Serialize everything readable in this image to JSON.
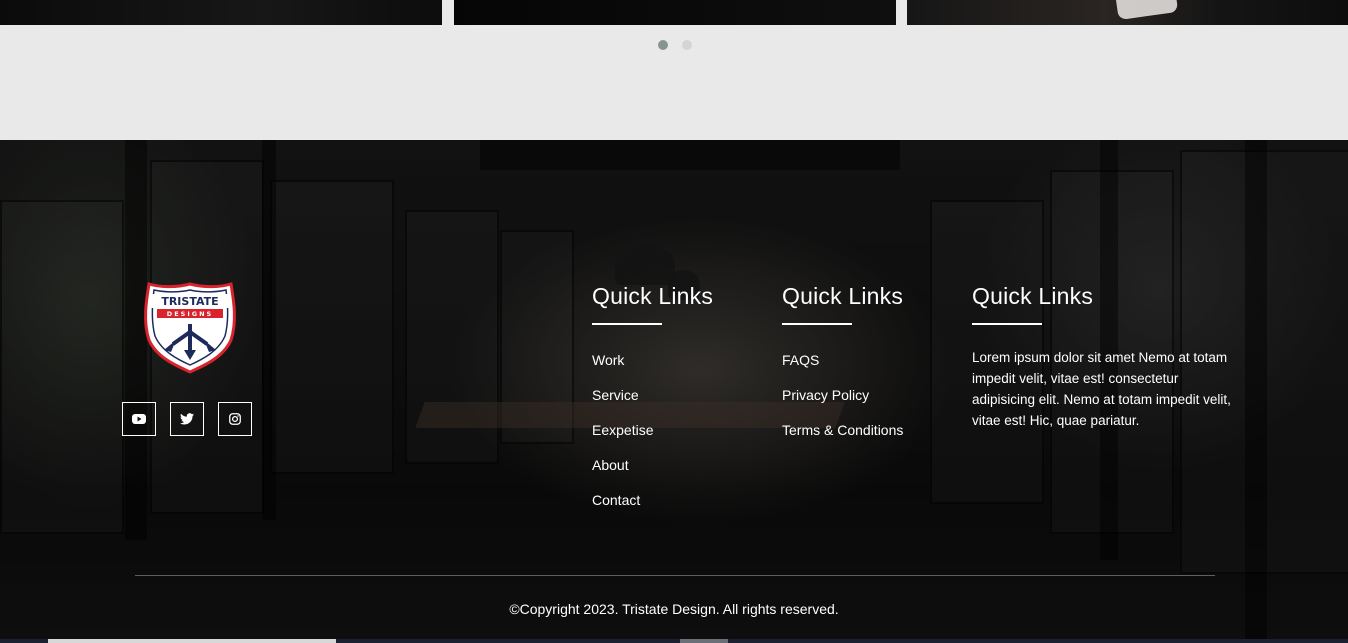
{
  "carousel": {
    "dots": [
      {
        "label": "slide-1",
        "active": true
      },
      {
        "label": "slide-2",
        "active": false
      }
    ]
  },
  "footer": {
    "logo": {
      "top_text": "TRISTATE",
      "sub_text": "DESIGNS",
      "colors": {
        "red": "#d9232d",
        "navy": "#1d2a5c",
        "white": "#ffffff"
      }
    },
    "socials": [
      {
        "name": "youtube-icon"
      },
      {
        "name": "twitter-icon"
      },
      {
        "name": "instagram-icon"
      }
    ],
    "columns": [
      {
        "heading": "Quick Links",
        "links": [
          "Work",
          "Service",
          "Eexpetise",
          "About",
          "Contact"
        ]
      },
      {
        "heading": "Quick Links",
        "links": [
          "FAQS",
          "Privacy Policy",
          "Terms & Conditions"
        ]
      },
      {
        "heading": "Quick Links",
        "text": "Lorem ipsum dolor sit amet Nemo at totam impedit velit, vitae est! consectetur adipisicing elit. Nemo at totam impedit velit, vitae est! Hic, quae pariatur."
      }
    ],
    "copyright": "©Copyright 2023. Tristate Design. All rights reserved."
  }
}
